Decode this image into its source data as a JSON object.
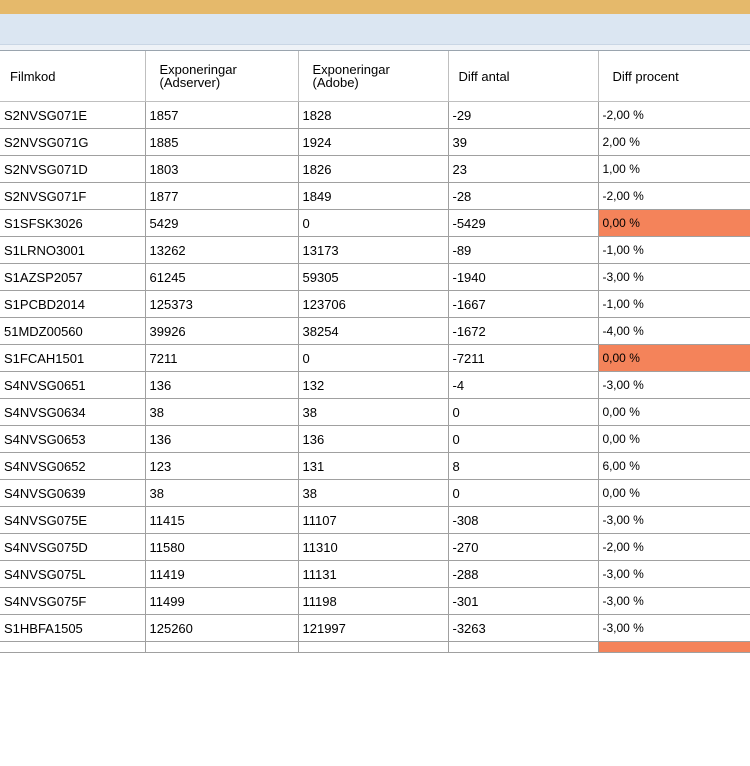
{
  "columns": {
    "filmkod": "Filmkod",
    "adserver_line1": "Exponeringar",
    "adserver_line2": "(Adserver)",
    "adobe_line1": "Exponeringar",
    "adobe_line2": "(Adobe)",
    "diff_antal": "Diff antal",
    "diff_procent": "Diff procent"
  },
  "colors": {
    "title_bar": "#e5b96b",
    "sub_bar": "#dbe6f2",
    "warn_cell": "#f4835a"
  },
  "rows": [
    {
      "filmkod": "S2NVSG071E",
      "adserver": "1857",
      "adobe": "1828",
      "diff_antal": "-29",
      "diff_procent": "-2,00 %",
      "flag": false
    },
    {
      "filmkod": "S2NVSG071G",
      "adserver": "1885",
      "adobe": "1924",
      "diff_antal": "39",
      "diff_procent": "2,00 %",
      "flag": false
    },
    {
      "filmkod": "S2NVSG071D",
      "adserver": "1803",
      "adobe": "1826",
      "diff_antal": "23",
      "diff_procent": "1,00 %",
      "flag": false
    },
    {
      "filmkod": "S2NVSG071F",
      "adserver": "1877",
      "adobe": "1849",
      "diff_antal": "-28",
      "diff_procent": "-2,00 %",
      "flag": false
    },
    {
      "filmkod": "S1SFSK3026",
      "adserver": "5429",
      "adobe": "0",
      "diff_antal": "-5429",
      "diff_procent": "0,00 %",
      "flag": true
    },
    {
      "filmkod": "S1LRNO3001",
      "adserver": "13262",
      "adobe": "13173",
      "diff_antal": "-89",
      "diff_procent": "-1,00 %",
      "flag": false
    },
    {
      "filmkod": "S1AZSP2057",
      "adserver": "61245",
      "adobe": "59305",
      "diff_antal": "-1940",
      "diff_procent": "-3,00 %",
      "flag": false
    },
    {
      "filmkod": "S1PCBD2014",
      "adserver": "125373",
      "adobe": "123706",
      "diff_antal": "-1667",
      "diff_procent": "-1,00 %",
      "flag": false
    },
    {
      "filmkod": "51MDZ00560",
      "adserver": "39926",
      "adobe": "38254",
      "diff_antal": "-1672",
      "diff_procent": "-4,00 %",
      "flag": false
    },
    {
      "filmkod": "S1FCAH1501",
      "adserver": "7211",
      "adobe": "0",
      "diff_antal": "-7211",
      "diff_procent": "0,00 %",
      "flag": true
    },
    {
      "filmkod": "S4NVSG0651",
      "adserver": "136",
      "adobe": "132",
      "diff_antal": "-4",
      "diff_procent": "-3,00 %",
      "flag": false
    },
    {
      "filmkod": "S4NVSG0634",
      "adserver": "38",
      "adobe": "38",
      "diff_antal": "0",
      "diff_procent": "0,00 %",
      "flag": false
    },
    {
      "filmkod": "S4NVSG0653",
      "adserver": "136",
      "adobe": "136",
      "diff_antal": "0",
      "diff_procent": "0,00 %",
      "flag": false
    },
    {
      "filmkod": "S4NVSG0652",
      "adserver": "123",
      "adobe": "131",
      "diff_antal": "8",
      "diff_procent": "6,00 %",
      "flag": false
    },
    {
      "filmkod": "S4NVSG0639",
      "adserver": "38",
      "adobe": "38",
      "diff_antal": "0",
      "diff_procent": "0,00 %",
      "flag": false
    },
    {
      "filmkod": "S4NVSG075E",
      "adserver": "11415",
      "adobe": "11107",
      "diff_antal": "-308",
      "diff_procent": "-3,00 %",
      "flag": false
    },
    {
      "filmkod": "S4NVSG075D",
      "adserver": "11580",
      "adobe": "11310",
      "diff_antal": "-270",
      "diff_procent": "-2,00 %",
      "flag": false
    },
    {
      "filmkod": "S4NVSG075L",
      "adserver": "11419",
      "adobe": "11131",
      "diff_antal": "-288",
      "diff_procent": "-3,00 %",
      "flag": false
    },
    {
      "filmkod": "S4NVSG075F",
      "adserver": "11499",
      "adobe": "11198",
      "diff_antal": "-301",
      "diff_procent": "-3,00 %",
      "flag": false
    },
    {
      "filmkod": "S1HBFA1505",
      "adserver": "125260",
      "adobe": "121997",
      "diff_antal": "-3263",
      "diff_procent": "-3,00 %",
      "flag": false
    }
  ],
  "partial_row": {
    "flag": true
  }
}
